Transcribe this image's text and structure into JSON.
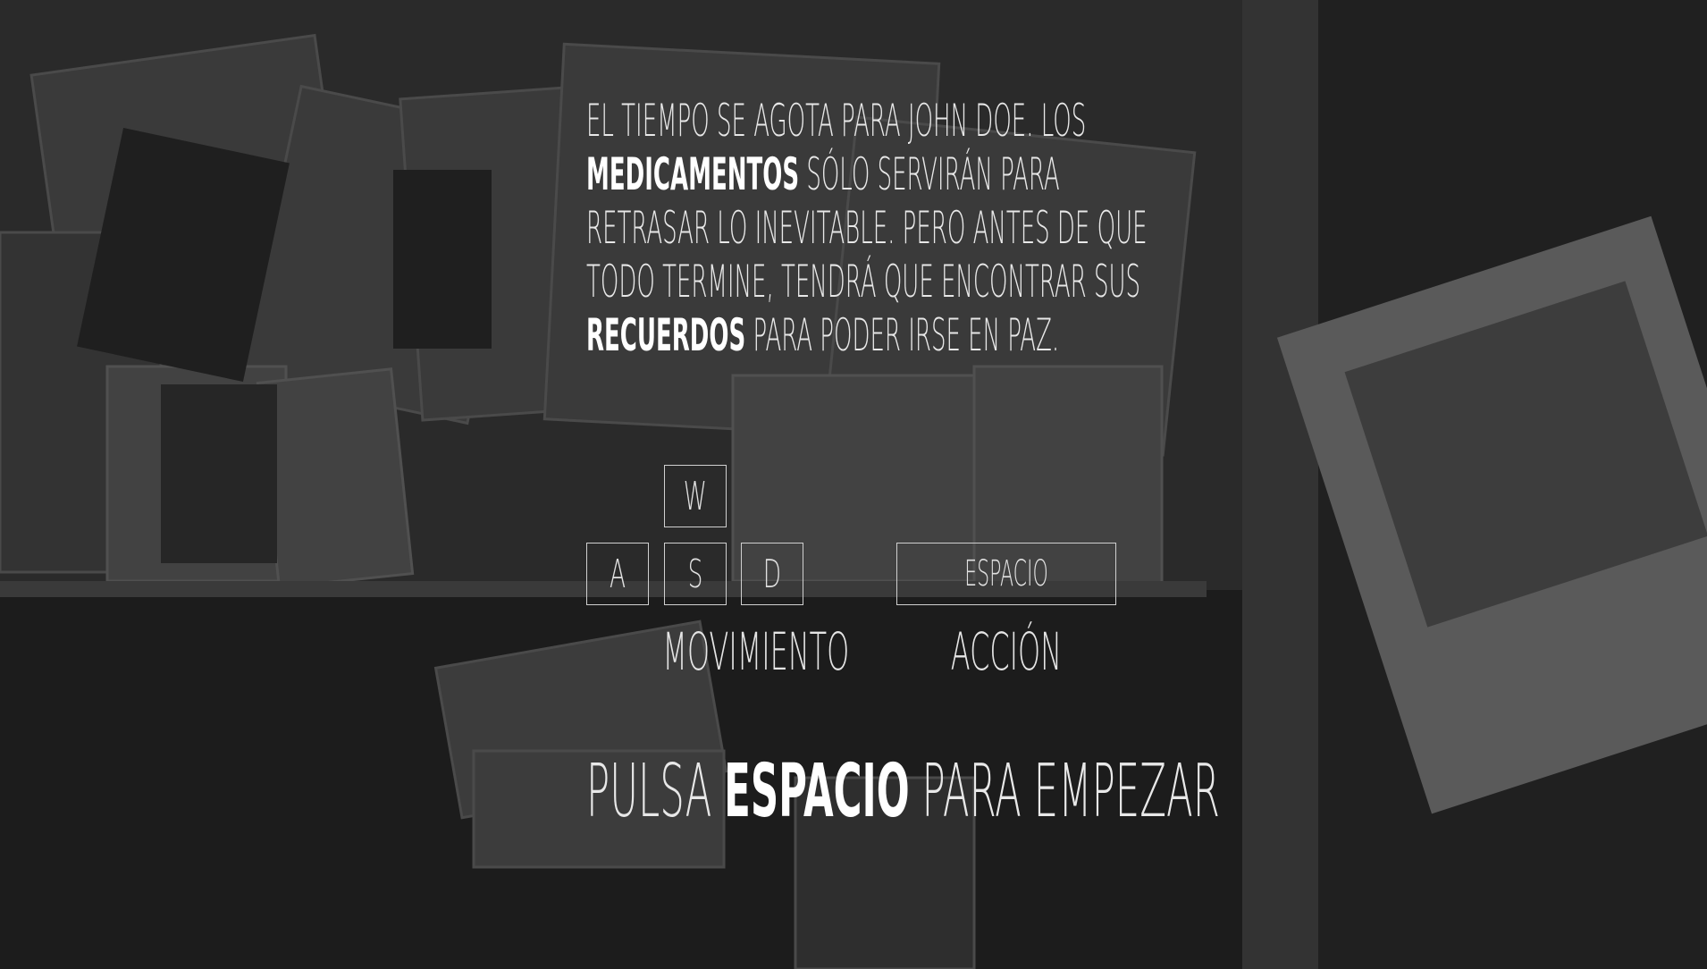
{
  "story": {
    "lines": [
      [
        "EL TIEMPO SE AGOTA PARA JOHN DOE. LOS"
      ],
      [
        "MEDICAMENTOS",
        " SÓLO SERVIRÁN PARA"
      ],
      [
        "RETRASAR LO INEVITABLE. PERO ANTES DE QUE"
      ],
      [
        "TODO TERMINE, TENDRÁ QUE ENCONTRAR SUS"
      ],
      [
        "RECUERDOS",
        " PARA PODER IRSE EN PAZ."
      ]
    ],
    "line1": "EL TIEMPO SE AGOTA PARA JOHN DOE. LOS",
    "line2_bold": "MEDICAMENTOS",
    "line2_rest": " SÓLO SERVIRÁN PARA",
    "line3": "RETRASAR LO INEVITABLE. PERO ANTES DE QUE",
    "line4": "TODO TERMINE, TENDRÁ QUE ENCONTRAR SUS",
    "line5_bold": "RECUERDOS",
    "line5_rest": " PARA PODER IRSE EN PAZ."
  },
  "controls": {
    "key_w": "W",
    "key_a": "A",
    "key_s": "S",
    "key_d": "D",
    "key_space": "ESPACIO",
    "movement_label": "MOVIMIENTO",
    "action_label": "ACCIÓN"
  },
  "prompt": {
    "prefix": "PULSA ",
    "key": "ESPACIO",
    "suffix": " PARA EMPEZAR"
  },
  "colors": {
    "background": "#1a1a1a",
    "text": "#e8e8e8",
    "key_border": "#d0d0d0"
  }
}
